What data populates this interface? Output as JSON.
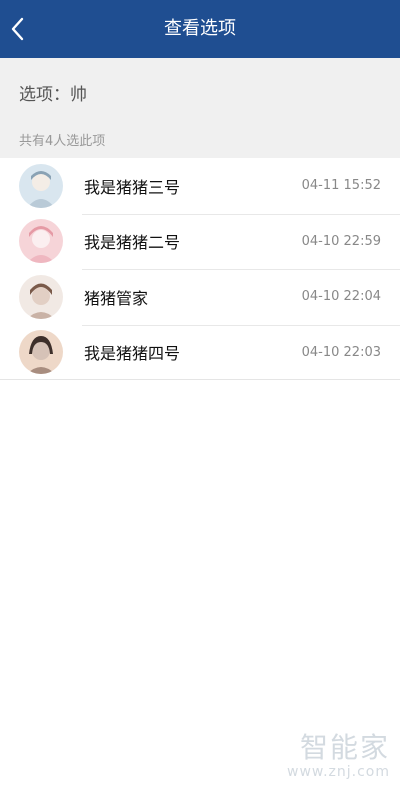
{
  "header": {
    "title": "查看选项",
    "back_icon": "chevron-left-icon"
  },
  "option": {
    "label": "选项：帅"
  },
  "summary": {
    "count_text": "共有4人选此项"
  },
  "voters": [
    {
      "name": "我是猪猪三号",
      "time": "04-11 15:52",
      "avatar_colors": [
        "#d9e6ef",
        "#8aa2b4",
        "#f4ede6"
      ]
    },
    {
      "name": "我是猪猪二号",
      "time": "04-10 22:59",
      "avatar_colors": [
        "#f6d4d8",
        "#e59aa5",
        "#fbeff0"
      ]
    },
    {
      "name": "猪猪管家",
      "time": "04-10 22:04",
      "avatar_colors": [
        "#f1e9e4",
        "#7a5a4a",
        "#e2cfc4"
      ]
    },
    {
      "name": "我是猪猪四号",
      "time": "04-10 22:03",
      "avatar_colors": [
        "#eed8c8",
        "#3d2f2a",
        "#d6c2b7"
      ]
    }
  ],
  "watermark": {
    "main": "智能家",
    "sub": "www.znj.com"
  },
  "colors": {
    "header_bg": "#1f4e91",
    "page_bg": "#f0f0f0"
  }
}
